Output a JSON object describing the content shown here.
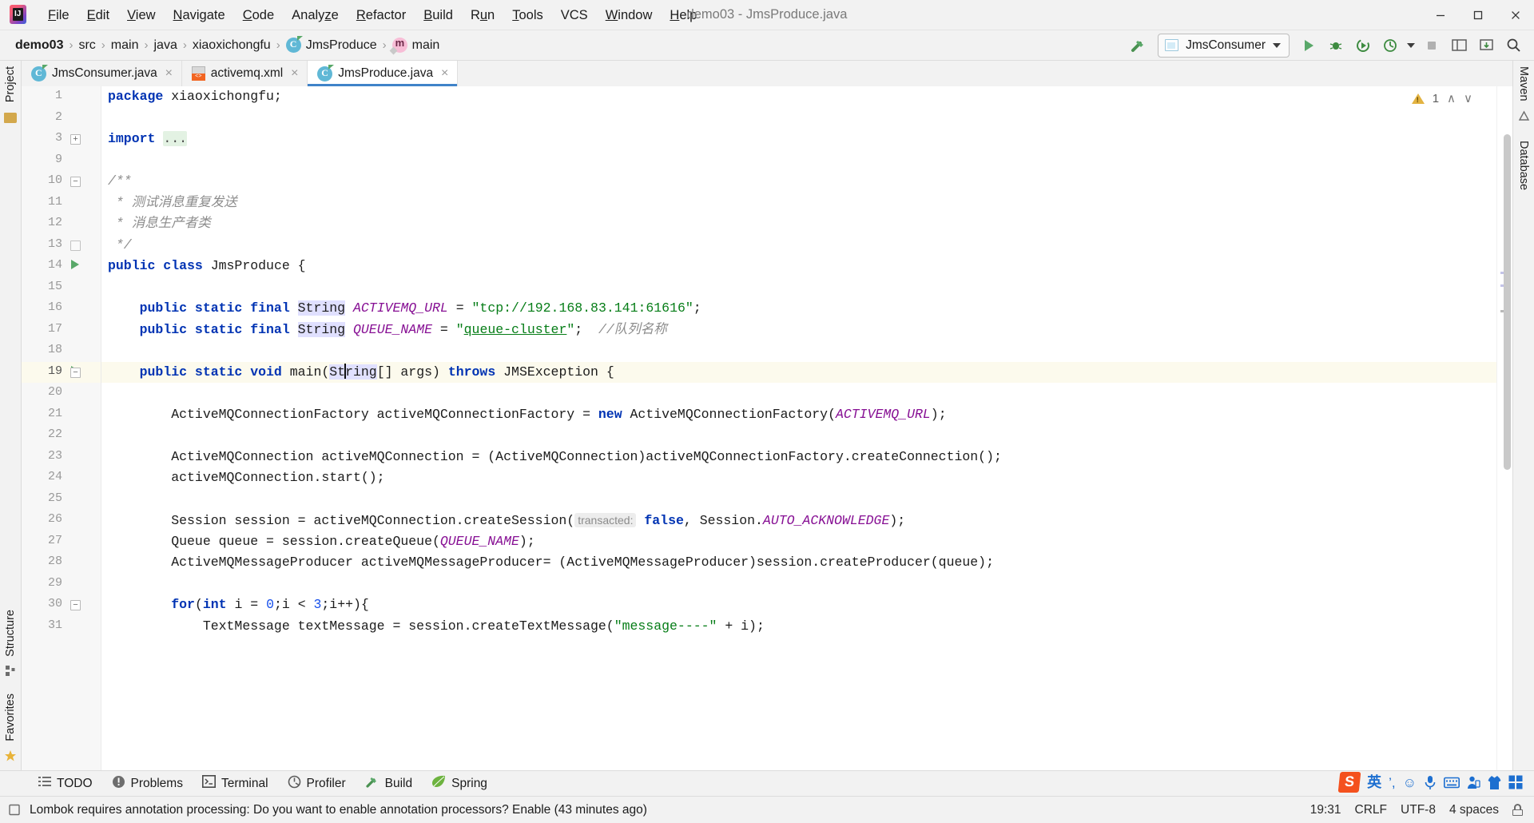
{
  "window": {
    "title": "demo03 - JmsProduce.java",
    "menus": [
      {
        "label": "File",
        "mnemonic": "F"
      },
      {
        "label": "Edit",
        "mnemonic": "E"
      },
      {
        "label": "View",
        "mnemonic": "V"
      },
      {
        "label": "Navigate",
        "mnemonic": "N"
      },
      {
        "label": "Code",
        "mnemonic": "C"
      },
      {
        "label": "Analyze",
        "mnemonic": "z"
      },
      {
        "label": "Refactor",
        "mnemonic": "R"
      },
      {
        "label": "Build",
        "mnemonic": "B"
      },
      {
        "label": "Run",
        "mnemonic": "u"
      },
      {
        "label": "Tools",
        "mnemonic": "T"
      },
      {
        "label": "VCS",
        "mnemonic": ""
      },
      {
        "label": "Window",
        "mnemonic": "W"
      },
      {
        "label": "Help",
        "mnemonic": "H"
      }
    ],
    "controls": {
      "minimize": "minimize-icon",
      "maximize": "maximize-icon",
      "close": "close-icon"
    }
  },
  "navbar": {
    "breadcrumbs": [
      {
        "label": "demo03",
        "icon": ""
      },
      {
        "label": "src",
        "icon": ""
      },
      {
        "label": "main",
        "icon": ""
      },
      {
        "label": "java",
        "icon": ""
      },
      {
        "label": "xiaoxichongfu",
        "icon": ""
      },
      {
        "label": "JmsProduce",
        "icon": "class-icon"
      },
      {
        "label": "main",
        "icon": "method-icon"
      }
    ],
    "separator": "›",
    "build_icon": "hammer-build-icon",
    "run_configuration": "JmsConsumer",
    "run_config_icon": "application-icon",
    "actions": [
      {
        "name": "run-button",
        "icon": "play-icon",
        "color": "#59a869"
      },
      {
        "name": "debug-button",
        "icon": "bug-icon",
        "color": "#3d8b40"
      },
      {
        "name": "run-coverage-button",
        "icon": "coverage-icon",
        "color": "#3d8b40"
      },
      {
        "name": "profile-button",
        "icon": "profiler-icon",
        "color": "#3d8b40"
      },
      {
        "name": "profile-dropdown",
        "icon": "chevron-down-icon",
        "color": "#3c3c3c"
      },
      {
        "name": "stop-button",
        "icon": "stop-icon",
        "color": "#b0b0b0"
      },
      {
        "name": "project-structure-button",
        "icon": "module-icon",
        "color": "#5c5c5c"
      },
      {
        "name": "update-project-button",
        "icon": "vcs-update-icon",
        "color": "#5c5c5c"
      },
      {
        "name": "search-everywhere-button",
        "icon": "search-icon",
        "color": "#3c3c3c"
      }
    ]
  },
  "left_strip": [
    {
      "label": "Project",
      "icon": "project-icon"
    },
    {
      "label": "Structure",
      "icon": "structure-icon"
    },
    {
      "label": "Favorites",
      "icon": "favorites-star-icon"
    }
  ],
  "right_strip": [
    {
      "label": "Maven",
      "icon": "maven-icon"
    },
    {
      "label": "Database",
      "icon": "database-icon"
    }
  ],
  "tabs": [
    {
      "label": "JmsConsumer.java",
      "icon": "java-class-icon",
      "active": false,
      "close": "×"
    },
    {
      "label": "activemq.xml",
      "icon": "xml-file-icon",
      "active": false,
      "close": "×"
    },
    {
      "label": "JmsProduce.java",
      "icon": "java-class-icon",
      "active": true,
      "close": "×"
    }
  ],
  "inspections": {
    "warning_count": "1",
    "up": "∧",
    "down": "∨"
  },
  "editor": {
    "lines": [
      {
        "no": "1",
        "fold": "",
        "run": false,
        "cur": false
      },
      {
        "no": "2",
        "fold": "",
        "run": false,
        "cur": false
      },
      {
        "no": "3",
        "fold": "plus",
        "run": false,
        "cur": false
      },
      {
        "no": "9",
        "fold": "",
        "run": false,
        "cur": false
      },
      {
        "no": "10",
        "fold": "minus",
        "run": false,
        "cur": false
      },
      {
        "no": "11",
        "fold": "",
        "run": false,
        "cur": false
      },
      {
        "no": "12",
        "fold": "",
        "run": false,
        "cur": false
      },
      {
        "no": "13",
        "fold": "end",
        "run": false,
        "cur": false
      },
      {
        "no": "14",
        "fold": "",
        "run": true,
        "cur": false
      },
      {
        "no": "15",
        "fold": "",
        "run": false,
        "cur": false
      },
      {
        "no": "16",
        "fold": "",
        "run": false,
        "cur": false
      },
      {
        "no": "17",
        "fold": "",
        "run": false,
        "cur": false
      },
      {
        "no": "18",
        "fold": "",
        "run": false,
        "cur": false
      },
      {
        "no": "19",
        "fold": "minus",
        "run": true,
        "cur": true
      },
      {
        "no": "20",
        "fold": "",
        "run": false,
        "cur": false
      },
      {
        "no": "21",
        "fold": "",
        "run": false,
        "cur": false
      },
      {
        "no": "22",
        "fold": "",
        "run": false,
        "cur": false
      },
      {
        "no": "23",
        "fold": "",
        "run": false,
        "cur": false
      },
      {
        "no": "24",
        "fold": "",
        "run": false,
        "cur": false
      },
      {
        "no": "25",
        "fold": "",
        "run": false,
        "cur": false
      },
      {
        "no": "26",
        "fold": "",
        "run": false,
        "cur": false
      },
      {
        "no": "27",
        "fold": "",
        "run": false,
        "cur": false
      },
      {
        "no": "28",
        "fold": "",
        "run": false,
        "cur": false
      },
      {
        "no": "29",
        "fold": "",
        "run": false,
        "cur": false
      },
      {
        "no": "30",
        "fold": "minus",
        "run": false,
        "cur": false
      },
      {
        "no": "31",
        "fold": "",
        "run": false,
        "cur": false
      }
    ],
    "source_text": [
      "package xiaoxichongfu;",
      "",
      "import ...",
      "",
      "/**",
      " * 测试消息重复发送",
      " * 消息生产者类",
      " */",
      "public class JmsProduce {",
      "",
      "    public static final String ACTIVEMQ_URL = \"tcp://192.168.83.141:61616\";",
      "    public static final String QUEUE_NAME = \"queue-cluster\";  //队列名称",
      "",
      "    public static void main(String[] args) throws JMSException {",
      "",
      "        ActiveMQConnectionFactory activeMQConnectionFactory = new ActiveMQConnectionFactory(ACTIVEMQ_URL);",
      "",
      "        ActiveMQConnection activeMQConnection = (ActiveMQConnection)activeMQConnectionFactory.createConnection();",
      "        activeMQConnection.start();",
      "",
      "        Session session = activeMQConnection.createSession( transacted: false, Session.AUTO_ACKNOWLEDGE);",
      "        Queue queue = session.createQueue(QUEUE_NAME);",
      "        ActiveMQMessageProducer activeMQMessageProducer= (ActiveMQMessageProducer)session.createProducer(queue);",
      "",
      "        for(int i = 0;i < 3;i++){",
      "            TextMessage textMessage = session.createTextMessage(\"message----\" + i);"
    ],
    "inlay_hint": "transacted:",
    "caret_line": "19"
  },
  "bottom_toolwindows": [
    {
      "label": "TODO",
      "icon": "todo-list-icon"
    },
    {
      "label": "Problems",
      "icon": "problems-icon"
    },
    {
      "label": "Terminal",
      "icon": "terminal-icon"
    },
    {
      "label": "Profiler",
      "icon": "profiler-icon"
    },
    {
      "label": "Build",
      "icon": "hammer-build-icon"
    },
    {
      "label": "Spring",
      "icon": "spring-leaf-icon"
    }
  ],
  "statusbar": {
    "message_icon": "event-log-icon",
    "message": "Lombok requires annotation processing: Do you want to enable annotation processors? Enable (43 minutes ago)",
    "time": "19:31",
    "line_separator": "CRLF",
    "encoding": "UTF-8",
    "indent": "4 spaces",
    "lock_icon": "unlocked-icon"
  },
  "tray": {
    "items": [
      {
        "icon": "sogou-ime-icon",
        "label": "S"
      },
      {
        "icon": "chinese-english-toggle-icon",
        "label": "英"
      },
      {
        "icon": "punctuation-icon",
        "label": "’,"
      },
      {
        "icon": "emoji-icon",
        "label": "☺"
      },
      {
        "icon": "microphone-icon",
        "label": "♀"
      },
      {
        "icon": "keyboard-icon",
        "label": "⌨"
      },
      {
        "icon": "user-icon",
        "label": "☻"
      },
      {
        "icon": "skin-shirt-icon",
        "label": "▮"
      },
      {
        "icon": "toolbox-grid-icon",
        "label": "▦"
      }
    ]
  },
  "colors": {
    "accent": "#4083c9",
    "keyword": "#0033b3",
    "string": "#067d17",
    "constant": "#871094",
    "comment": "#8c8c8c",
    "number": "#1750eb",
    "current_line": "#fcfaed",
    "run_green": "#59a869",
    "chrome": "#f2f2f2"
  }
}
